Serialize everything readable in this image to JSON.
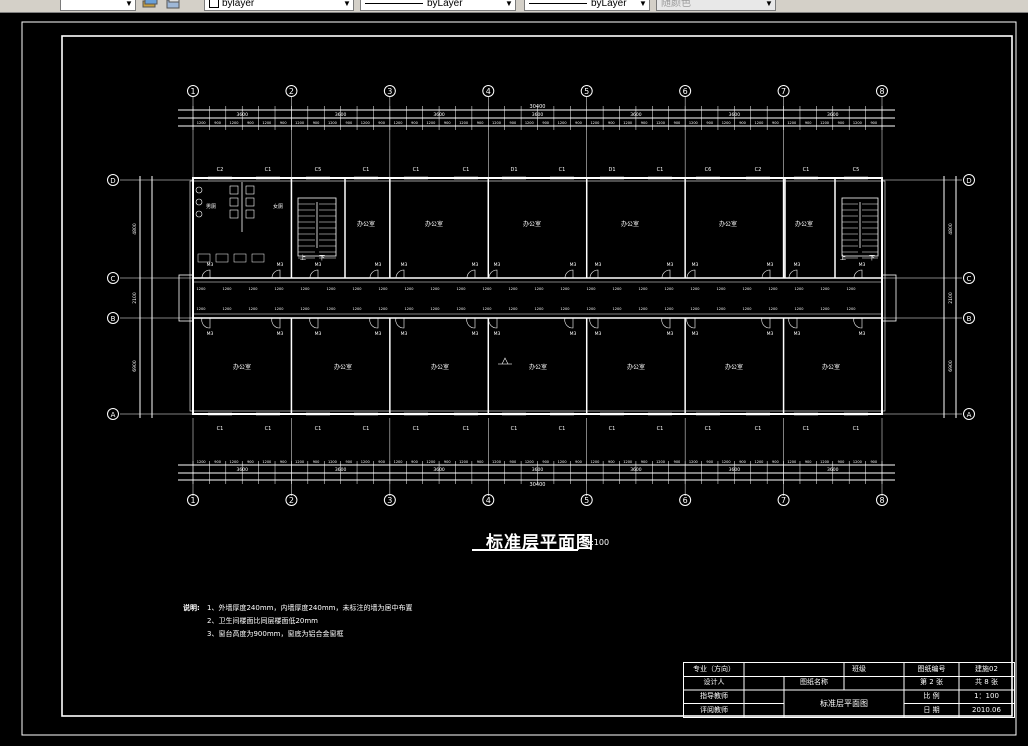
{
  "toolbar": {
    "layer_dropdown": {
      "value": "bylayer"
    },
    "linetype_dropdown": {
      "value": "byLayer"
    },
    "lineweight_dropdown": {
      "value": "byLayer"
    },
    "plotstyle_dropdown": {
      "value": "随颜色"
    }
  },
  "plan": {
    "axes_numbers": [
      "1",
      "2",
      "3",
      "4",
      "5",
      "6",
      "7",
      "8"
    ],
    "axes_letters": [
      "D",
      "C",
      "B",
      "A"
    ],
    "top_total": "30400",
    "top_bays": [
      "3600",
      "3600",
      "3600",
      "3600",
      "3600",
      "3600",
      "3600"
    ],
    "top_windows": [
      "C2",
      "C1",
      "C5",
      "C1",
      "C1",
      "C1",
      "D1",
      "C1",
      "D1",
      "C1",
      "C6"
    ],
    "bottom_windows": [
      "C1",
      "C1",
      "C1",
      "C1",
      "C1",
      "C1",
      "C1",
      "C1",
      "C1",
      "C1",
      "C1",
      "C1",
      "C1",
      "C1"
    ],
    "room_label": "办公室",
    "door_labels": [
      "M3",
      "M3",
      "M3",
      "M3",
      "M3",
      "M3",
      "M3",
      "M3",
      "M3",
      "M3",
      "M3",
      "M3",
      "M3",
      "M3"
    ],
    "left_dims": [
      "4800",
      "2100",
      "6900"
    ],
    "right_dims": [
      "4800",
      "2100",
      "6900"
    ],
    "toilet_labels": [
      "男厕",
      "女厕"
    ],
    "stair_labels": [
      "上",
      "下"
    ]
  },
  "drawing_title": "标准层平面图",
  "drawing_scale": "1:100",
  "notes": {
    "label": "说明:",
    "lines": [
      "1、外墙厚度240mm，内墙厚度240mm，未标注的墙为居中布置",
      "2、卫生间楼面比同层楼面低20mm",
      "3、窗台高度为900mm，窗底为铝合金窗框"
    ]
  },
  "title_block": {
    "major": "专业（方向）",
    "grade": "班级",
    "drawing_no_label": "图纸编号",
    "drawing_no": "建施02",
    "designer": "设计人",
    "drawing_name_label": "图纸名称",
    "sheet": "第 2 张",
    "total": "共 8 张",
    "advisor": "指导教师",
    "scale_label": "比 例",
    "scale": "1：100",
    "drawing_name": "标准层平面图",
    "reviewer": "评阅教师",
    "date_label": "日 期",
    "date": "2010.06"
  },
  "colors": {
    "background": "#000000",
    "lines": "#ffffff",
    "toolbar": "#d4d0c8"
  }
}
